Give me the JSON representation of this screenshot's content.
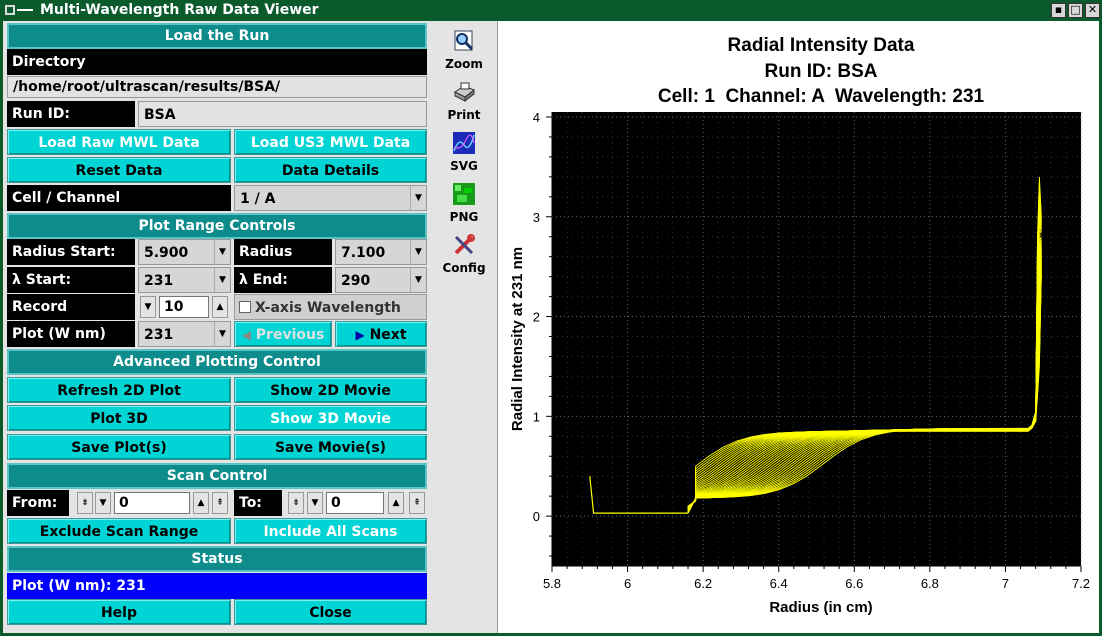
{
  "window": {
    "title": "Multi-Wavelength Raw Data Viewer",
    "controls": [
      "▪",
      "□",
      "✕"
    ]
  },
  "left": {
    "load_header": "Load the Run",
    "directory_label": "Directory",
    "directory_value": "/home/root/ultrascan/results/BSA/",
    "runid_label": "Run ID:",
    "runid_value": "BSA",
    "load_raw": "Load Raw MWL Data",
    "load_us3": "Load US3 MWL Data",
    "reset": "Reset Data",
    "details": "Data Details",
    "cellchan_label": "Cell / Channel",
    "cellchan_value": "1 / A",
    "range_header": "Plot Range Controls",
    "radius_start_label": "Radius Start:",
    "radius_start_value": "5.900",
    "radius_end_label": "Radius End:",
    "radius_end_value": "7.100",
    "lambda_start_label": "λ Start:",
    "lambda_start_value": "231",
    "lambda_end_label": "λ End:",
    "lambda_end_value": "290",
    "record_avg_label": "Record Average:",
    "record_avg_value": "10",
    "xaxis_wl_label": "X-axis Wavelength",
    "plot_wnm_label": "Plot (W nm)",
    "plot_wnm_value": "231",
    "previous": "Previous",
    "next": "Next",
    "adv_header": "Advanced Plotting Control",
    "refresh2d": "Refresh 2D Plot",
    "show2d": "Show 2D Movie",
    "plot3d": "Plot 3D",
    "show3d": "Show 3D Movie",
    "saveplots": "Save Plot(s)",
    "savemovies": "Save Movie(s)",
    "scan_header": "Scan Control",
    "from_label": "From:",
    "from_value": "0",
    "to_label": "To:",
    "to_value": "0",
    "exclude": "Exclude Scan Range",
    "include": "Include All Scans",
    "status_header": "Status",
    "status_value": "Plot (W nm): 231",
    "help": "Help",
    "close": "Close"
  },
  "tools": {
    "zoom": "Zoom",
    "print": "Print",
    "svg": "SVG",
    "png": "PNG",
    "config": "Config"
  },
  "chart_data": {
    "type": "line",
    "title": "Radial Intensity Data",
    "subtitle1": "Run ID: BSA",
    "subtitle2": "Cell: 1  Channel: A  Wavelength: 231",
    "xlabel": "Radius (in cm)",
    "ylabel": "Radial Intensity at 231 nm",
    "xlim": [
      5.8,
      7.2
    ],
    "ylim": [
      -0.5,
      4.05
    ],
    "xticks": [
      "5.8",
      "6",
      "6.2",
      "6.4",
      "6.6",
      "6.8",
      "7",
      "7.2"
    ],
    "xtick_values": [
      5.8,
      6.0,
      6.2,
      6.4,
      6.6,
      6.8,
      7.0,
      7.2
    ],
    "yticks": [
      "0",
      "1",
      "2",
      "3",
      "4"
    ],
    "ytick_values": [
      0,
      1,
      2,
      3,
      4
    ],
    "background": "#000000",
    "series_color": "#ffff00",
    "grid": true,
    "meniscus_x": [
      6.16,
      6.18
    ],
    "plateau_y": [
      0.15,
      0.9
    ],
    "baseline_y": 0.03,
    "bottom_x": 7.08,
    "bottom_peak_y": 3.3,
    "series_count": 40
  }
}
